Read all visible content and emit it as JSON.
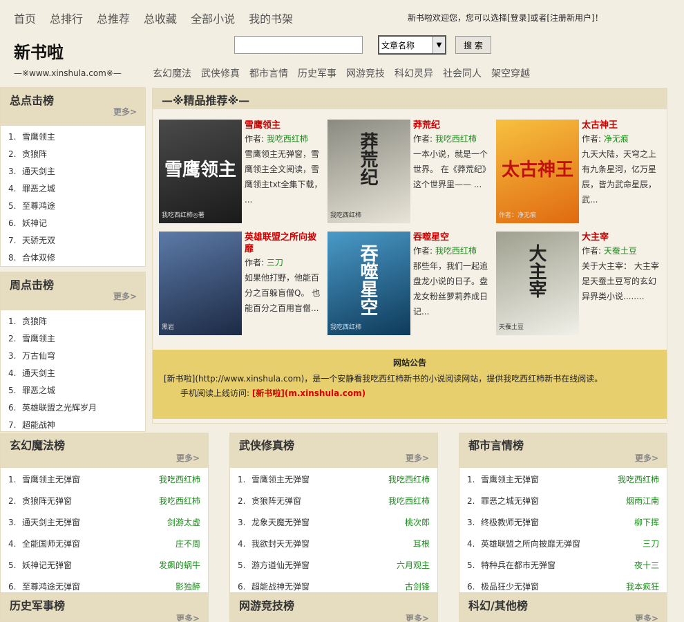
{
  "topnav": [
    "首页",
    "总排行",
    "总推荐",
    "总收藏",
    "全部小说",
    "我的书架"
  ],
  "welcome": "新书啦欢迎您，您可以选择[登录]或者[注册新用户]！",
  "logo": "新书啦",
  "domain": "—※www.xinshula.com※—",
  "search": {
    "value": "",
    "select": "文章名称",
    "button": "搜 索"
  },
  "catnav": [
    "玄幻魔法",
    "武侠修真",
    "都市言情",
    "历史军事",
    "网游竞技",
    "科幻灵异",
    "社会同人",
    "架空穿越"
  ],
  "more_label": "更多>",
  "total_clicks": {
    "title": "总点击榜",
    "items": [
      {
        "n": "1.",
        "t": "雪鹰领主"
      },
      {
        "n": "2.",
        "t": "贪狼阵"
      },
      {
        "n": "3.",
        "t": "通天剑主"
      },
      {
        "n": "4.",
        "t": "罪恶之城"
      },
      {
        "n": "5.",
        "t": "至尊鸿途"
      },
      {
        "n": "6.",
        "t": "妖神记"
      },
      {
        "n": "7.",
        "t": "天骄无双"
      },
      {
        "n": "8.",
        "t": "合体双修"
      }
    ]
  },
  "week_clicks": {
    "title": "周点击榜",
    "items": [
      {
        "n": "1.",
        "t": "贪狼阵"
      },
      {
        "n": "2.",
        "t": "雪鹰领主"
      },
      {
        "n": "3.",
        "t": "万古仙穹"
      },
      {
        "n": "4.",
        "t": "通天剑主"
      },
      {
        "n": "5.",
        "t": "罪恶之城"
      },
      {
        "n": "6.",
        "t": "英雄联盟之光辉岁月"
      },
      {
        "n": "7.",
        "t": "超能战神"
      }
    ]
  },
  "featured": {
    "title": "—※精品推荐※—",
    "author_label": "作者:",
    "books": [
      {
        "title": "雪鹰领主",
        "author": "我吃西红柿",
        "desc": "雪鹰领主无弹窗，雪鹰领主全文阅读，雪鹰领主txt全集下载， ...",
        "cover_text": "雪鹰领主",
        "cover_sub": "我吃西红柿◎著",
        "colors": [
          "#1a1a1a",
          "#4a4a4a"
        ]
      },
      {
        "title": "莽荒纪",
        "author": "我吃西红柿",
        "desc": "一本小说，就是一个世界。 在《莽荒纪》这个世界里—— ...",
        "cover_text": "莽荒纪",
        "cover_sub": "我吃西红柿",
        "colors": [
          "#e8e4d8",
          "#8a8a80"
        ]
      },
      {
        "title": "太古神王",
        "author": "净无痕",
        "desc": "九天大陆，天穹之上有九条星河，亿万星辰，皆为武命星辰，武...",
        "cover_text": "太古神王",
        "cover_sub": "作者：净无痕",
        "colors": [
          "#e06a10",
          "#f7c040"
        ]
      },
      {
        "title": "英雄联盟之所向披靡",
        "author": "三刀",
        "desc": "如果他打野，他能百分之百躲盲僧Q。 也能百分之百用盲僧...",
        "cover_text": "",
        "cover_sub": "黑岩",
        "colors": [
          "#1c2a44",
          "#5c7aa8"
        ]
      },
      {
        "title": "吞噬星空",
        "author": "我吃西红柿",
        "desc": "那些年，我们一起追盘龙小说的日子。盘龙女粉丝萝莉养成日记...",
        "cover_text": "吞噬星空",
        "cover_sub": "我吃西红柿",
        "colors": [
          "#0e3a5a",
          "#4a9ac8"
        ]
      },
      {
        "title": "大主宰",
        "author": "天蚕土豆",
        "desc": "关于大主宰： 大主宰是天蚕土豆写的玄幻异界类小说........",
        "cover_text": "大主宰",
        "cover_sub": "天蚕土豆",
        "colors": [
          "#f0f0e8",
          "#a0a090"
        ]
      }
    ]
  },
  "notice": {
    "title": "网站公告",
    "line1": "[新书啦](http://www.xinshula.com)，是一个安静看我吃西红柿新书的小说阅读网站，提供我吃西红柿新书在线阅读。",
    "line2_prefix": "手机阅读上线访问:",
    "line2_link": "[新书啦](m.xinshula.com)"
  },
  "categories": [
    {
      "title": "玄幻魔法榜",
      "items": [
        {
          "n": "1.",
          "t": "雪鹰领主无弹窗",
          "a": "我吃西红柿"
        },
        {
          "n": "2.",
          "t": "贪狼阵无弹窗",
          "a": "我吃西红柿"
        },
        {
          "n": "3.",
          "t": "通天剑主无弹窗",
          "a": "剑游太虚"
        },
        {
          "n": "4.",
          "t": "全能国师无弹窗",
          "a": "庄不周"
        },
        {
          "n": "5.",
          "t": "妖神记无弹窗",
          "a": "发飙的蜗牛"
        },
        {
          "n": "6.",
          "t": "至尊鸿途无弹窗",
          "a": "影独醉"
        }
      ]
    },
    {
      "title": "武侠修真榜",
      "items": [
        {
          "n": "1.",
          "t": "雪鹰领主无弹窗",
          "a": "我吃西红柿"
        },
        {
          "n": "2.",
          "t": "贪狼阵无弹窗",
          "a": "我吃西红柿"
        },
        {
          "n": "3.",
          "t": "龙象天魔无弹窗",
          "a": "桃次郎"
        },
        {
          "n": "4.",
          "t": "我欲封天无弹窗",
          "a": "耳根"
        },
        {
          "n": "5.",
          "t": "游方道仙无弹窗",
          "a": "六月观主"
        },
        {
          "n": "6.",
          "t": "超能战神无弹窗",
          "a": "古剑锋"
        }
      ]
    },
    {
      "title": "都市言情榜",
      "items": [
        {
          "n": "1.",
          "t": "雪鹰领主无弹窗",
          "a": "我吃西红柿"
        },
        {
          "n": "2.",
          "t": "罪恶之城无弹窗",
          "a": "烟雨江南"
        },
        {
          "n": "3.",
          "t": "终极教师无弹窗",
          "a": "柳下挥"
        },
        {
          "n": "4.",
          "t": "英雄联盟之所向披靡无弹窗",
          "a": "三刀"
        },
        {
          "n": "5.",
          "t": "特种兵在都市无弹窗",
          "a": "夜十三"
        },
        {
          "n": "6.",
          "t": "极品狂少无弹窗",
          "a": "我本疯狂"
        }
      ]
    }
  ],
  "bottom_categories": [
    "历史军事榜",
    "网游竞技榜",
    "科幻/其他榜"
  ]
}
